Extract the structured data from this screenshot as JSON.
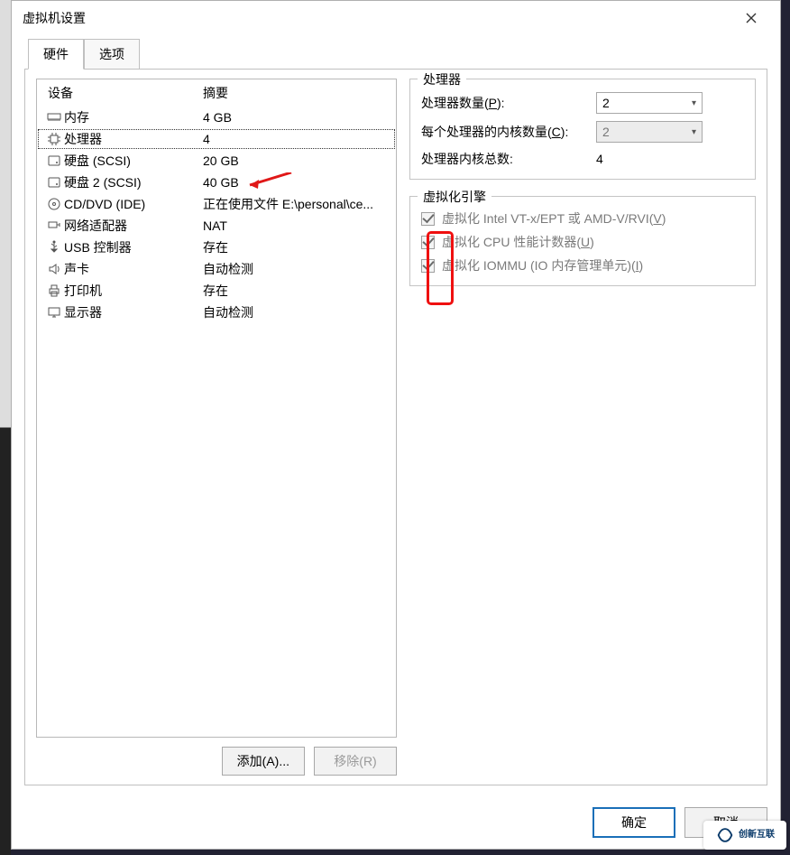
{
  "titlebar": {
    "title": "虚拟机设置"
  },
  "tabs": {
    "hardware": "硬件",
    "options": "选项"
  },
  "device_headers": {
    "name": "设备",
    "summary": "摘要"
  },
  "devices": [
    {
      "icon": "memory-icon",
      "name": "内存",
      "summary": "4 GB"
    },
    {
      "icon": "cpu-icon",
      "name": "处理器",
      "summary": "4"
    },
    {
      "icon": "disk-icon",
      "name": "硬盘 (SCSI)",
      "summary": "20 GB"
    },
    {
      "icon": "disk-icon",
      "name": "硬盘 2 (SCSI)",
      "summary": "40 GB"
    },
    {
      "icon": "cd-icon",
      "name": "CD/DVD (IDE)",
      "summary": "正在使用文件 E:\\personal\\ce..."
    },
    {
      "icon": "nic-icon",
      "name": "网络适配器",
      "summary": "NAT"
    },
    {
      "icon": "usb-icon",
      "name": "USB 控制器",
      "summary": "存在"
    },
    {
      "icon": "sound-icon",
      "name": "声卡",
      "summary": "自动检测"
    },
    {
      "icon": "printer-icon",
      "name": "打印机",
      "summary": "存在"
    },
    {
      "icon": "display-icon",
      "name": "显示器",
      "summary": "自动检测"
    }
  ],
  "left_buttons": {
    "add": "添加(A)...",
    "remove": "移除(R)"
  },
  "processor_group": {
    "title": "处理器",
    "proc_count_label_pre": "处理器数量(",
    "proc_count_hotkey": "P",
    "proc_count_label_post": "):",
    "proc_count_value": "2",
    "cores_label_pre": "每个处理器的内核数量(",
    "cores_hotkey": "C",
    "cores_label_post": "):",
    "cores_value": "2",
    "total_label": "处理器内核总数:",
    "total_value": "4"
  },
  "virt_group": {
    "title": "虚拟化引擎",
    "vt_pre": "虚拟化 Intel VT-x/EPT 或 AMD-V/RVI(",
    "vt_hotkey": "V",
    "vt_post": ")",
    "cpu_pre": "虚拟化 CPU 性能计数器(",
    "cpu_hotkey": "U",
    "cpu_post": ")",
    "iommu_pre": "虚拟化 IOMMU (IO 内存管理单元)(",
    "iommu_hotkey": "I",
    "iommu_post": ")"
  },
  "footer": {
    "ok": "确定",
    "cancel": "取消"
  },
  "watermark": {
    "text": "创新互联"
  }
}
